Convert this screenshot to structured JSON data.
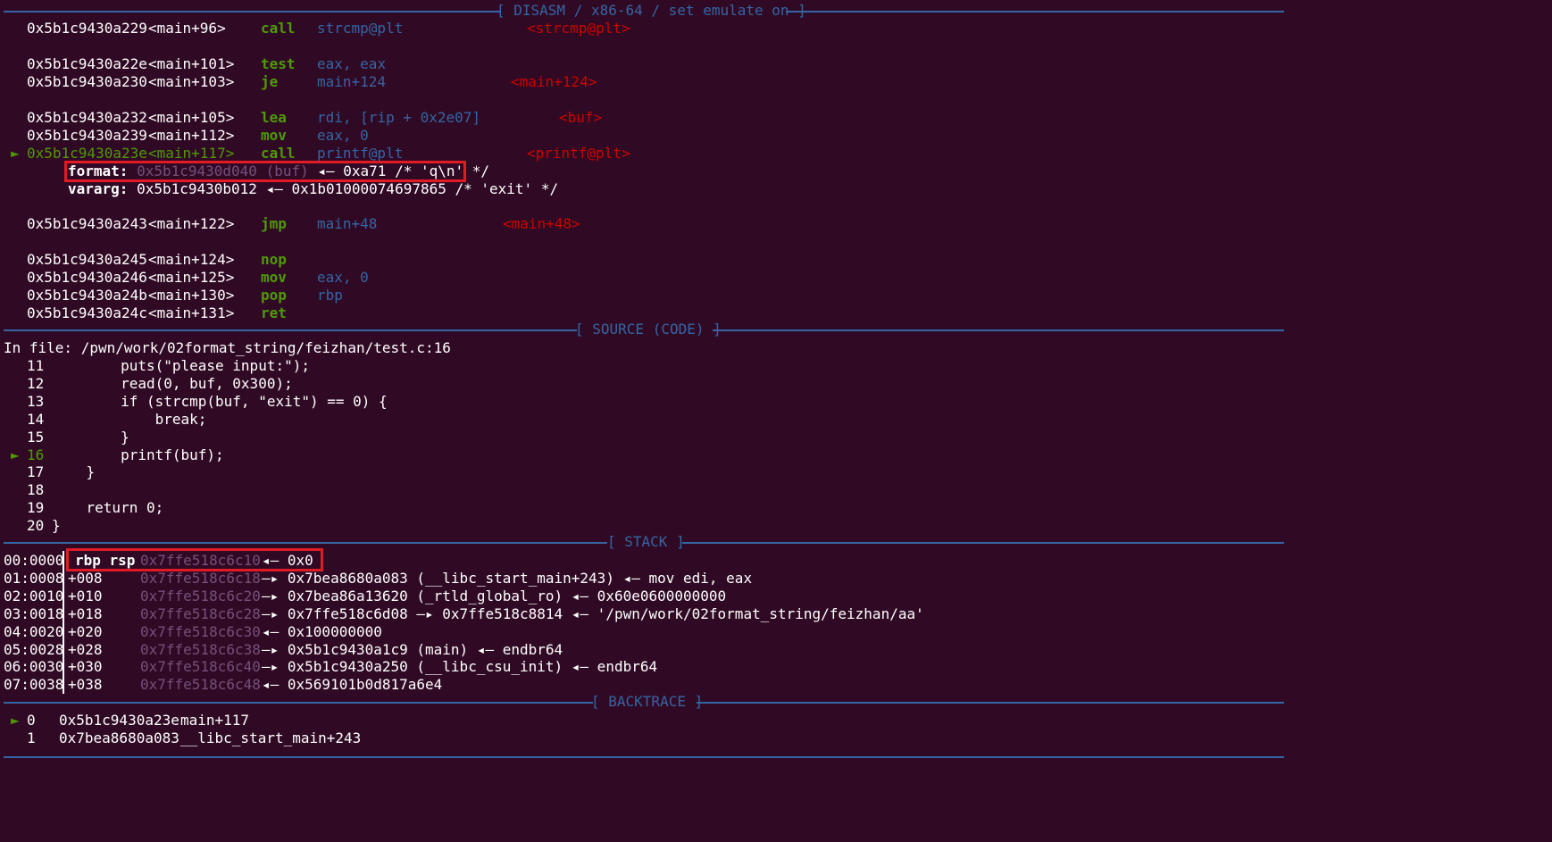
{
  "disasm": {
    "banner": "[ DISASM / x86-64 / set emulate on ]",
    "rows": [
      {
        "addr": "0x5b1c9430a229",
        "sym": "<main+96>",
        "mn": "call",
        "op1": "strcmp@plt",
        "op2": "",
        "note": "<strcmp@plt>",
        "current": false
      },
      {
        "addr": "0x5b1c9430a22e",
        "sym": "<main+101>",
        "mn": "test",
        "op1": "eax",
        "op2": "eax",
        "note": "",
        "current": false
      },
      {
        "addr": "0x5b1c9430a230",
        "sym": "<main+103>",
        "mn": "je",
        "op1": "main+124",
        "op2": "",
        "note": "<main+124>",
        "current": false
      },
      {
        "addr": "0x5b1c9430a232",
        "sym": "<main+105>",
        "mn": "lea",
        "op1": "rdi",
        "op2": "[rip + 0x2e07]",
        "note": "<buf>",
        "current": false
      },
      {
        "addr": "0x5b1c9430a239",
        "sym": "<main+112>",
        "mn": "mov",
        "op1": "eax",
        "op2": "0",
        "note": "",
        "current": false
      },
      {
        "addr": "0x5b1c9430a23e",
        "sym": "<main+117>",
        "mn": "call",
        "op1": "printf@plt",
        "op2": "",
        "note": "<printf@plt>",
        "current": true
      },
      {
        "addr": "0x5b1c9430a243",
        "sym": "<main+122>",
        "mn": "jmp",
        "op1": "main+48",
        "op2": "",
        "note": "<main+48>",
        "current": false
      },
      {
        "addr": "0x5b1c9430a245",
        "sym": "<main+124>",
        "mn": "nop",
        "op1": "",
        "op2": "",
        "note": "",
        "current": false
      },
      {
        "addr": "0x5b1c9430a246",
        "sym": "<main+125>",
        "mn": "mov",
        "op1": "eax",
        "op2": "0",
        "note": "",
        "current": false
      },
      {
        "addr": "0x5b1c9430a24b",
        "sym": "<main+130>",
        "mn": "pop",
        "op1": "rbp",
        "op2": "",
        "note": "",
        "current": false
      },
      {
        "addr": "0x5b1c9430a24c",
        "sym": "<main+131>",
        "mn": "ret",
        "op1": "",
        "op2": "",
        "note": "",
        "current": false
      }
    ],
    "format_label": "format:",
    "format_addr": "0x5b1c9430d040 (buf)",
    "format_value": "◂— 0xa71 /* 'q\\n' */",
    "vararg_label": "vararg:",
    "vararg_value": "0x5b1c9430b012 ◂— 0x1b01000074697865 /* 'exit' */"
  },
  "source": {
    "banner": "[ SOURCE (CODE) ]",
    "file": "In file: /pwn/work/02format_string/feizhan/test.c:16",
    "lines": [
      {
        "no": "11",
        "code": "        puts(\"please input:\");"
      },
      {
        "no": "12",
        "code": "        read(0, buf, 0x300);"
      },
      {
        "no": "13",
        "code": "        if (strcmp(buf, \"exit\") == 0) {"
      },
      {
        "no": "14",
        "code": "            break;"
      },
      {
        "no": "15",
        "code": "        }"
      },
      {
        "no": "16",
        "code": "        printf(buf);"
      },
      {
        "no": "17",
        "code": "    }"
      },
      {
        "no": "18",
        "code": ""
      },
      {
        "no": "19",
        "code": "    return 0;"
      },
      {
        "no": "20",
        "code": "}"
      }
    ]
  },
  "stack": {
    "banner": "[ STACK ]",
    "rows": [
      {
        "idx": "00:0000",
        "regs": "rbp rsp",
        "addr": "0x7ffe518c6c10",
        "rest": "◂— 0x0"
      },
      {
        "idx": "01:0008",
        "regs": "+008",
        "addr": "0x7ffe518c6c18",
        "rest": "—▸ 0x7bea8680a083 (__libc_start_main+243) ◂— mov edi, eax"
      },
      {
        "idx": "02:0010",
        "regs": "+010",
        "addr": "0x7ffe518c6c20",
        "rest": "—▸ 0x7bea86a13620 (_rtld_global_ro) ◂— 0x60e0600000000"
      },
      {
        "idx": "03:0018",
        "regs": "+018",
        "addr": "0x7ffe518c6c28",
        "rest": "—▸ 0x7ffe518c6d08 —▸ 0x7ffe518c8814 ◂— '/pwn/work/02format_string/feizhan/aa'"
      },
      {
        "idx": "04:0020",
        "regs": "+020",
        "addr": "0x7ffe518c6c30",
        "rest": "◂— 0x100000000"
      },
      {
        "idx": "05:0028",
        "regs": "+028",
        "addr": "0x7ffe518c6c38",
        "rest": "—▸ 0x5b1c9430a1c9 (main) ◂— endbr64"
      },
      {
        "idx": "06:0030",
        "regs": "+030",
        "addr": "0x7ffe518c6c40",
        "rest": "—▸ 0x5b1c9430a250 (__libc_csu_init) ◂— endbr64"
      },
      {
        "idx": "07:0038",
        "regs": "+038",
        "addr": "0x7ffe518c6c48",
        "rest": "◂— 0x569101b0d817a6e4"
      }
    ]
  },
  "backtrace": {
    "banner": "[ BACKTRACE ]",
    "frames": [
      {
        "n": "0",
        "addr": "0x5b1c9430a23e",
        "sym": "main+117",
        "current": true
      },
      {
        "n": "1",
        "addr": "0x7bea8680a083",
        "sym": "__libc_start_main+243",
        "current": false
      }
    ]
  },
  "colors": {
    "background": "#300a24",
    "banner": "#3465a4",
    "mnemonic": "#4e9a06",
    "symbol_red": "#cc0000",
    "highlight_box": "#e01b24"
  }
}
